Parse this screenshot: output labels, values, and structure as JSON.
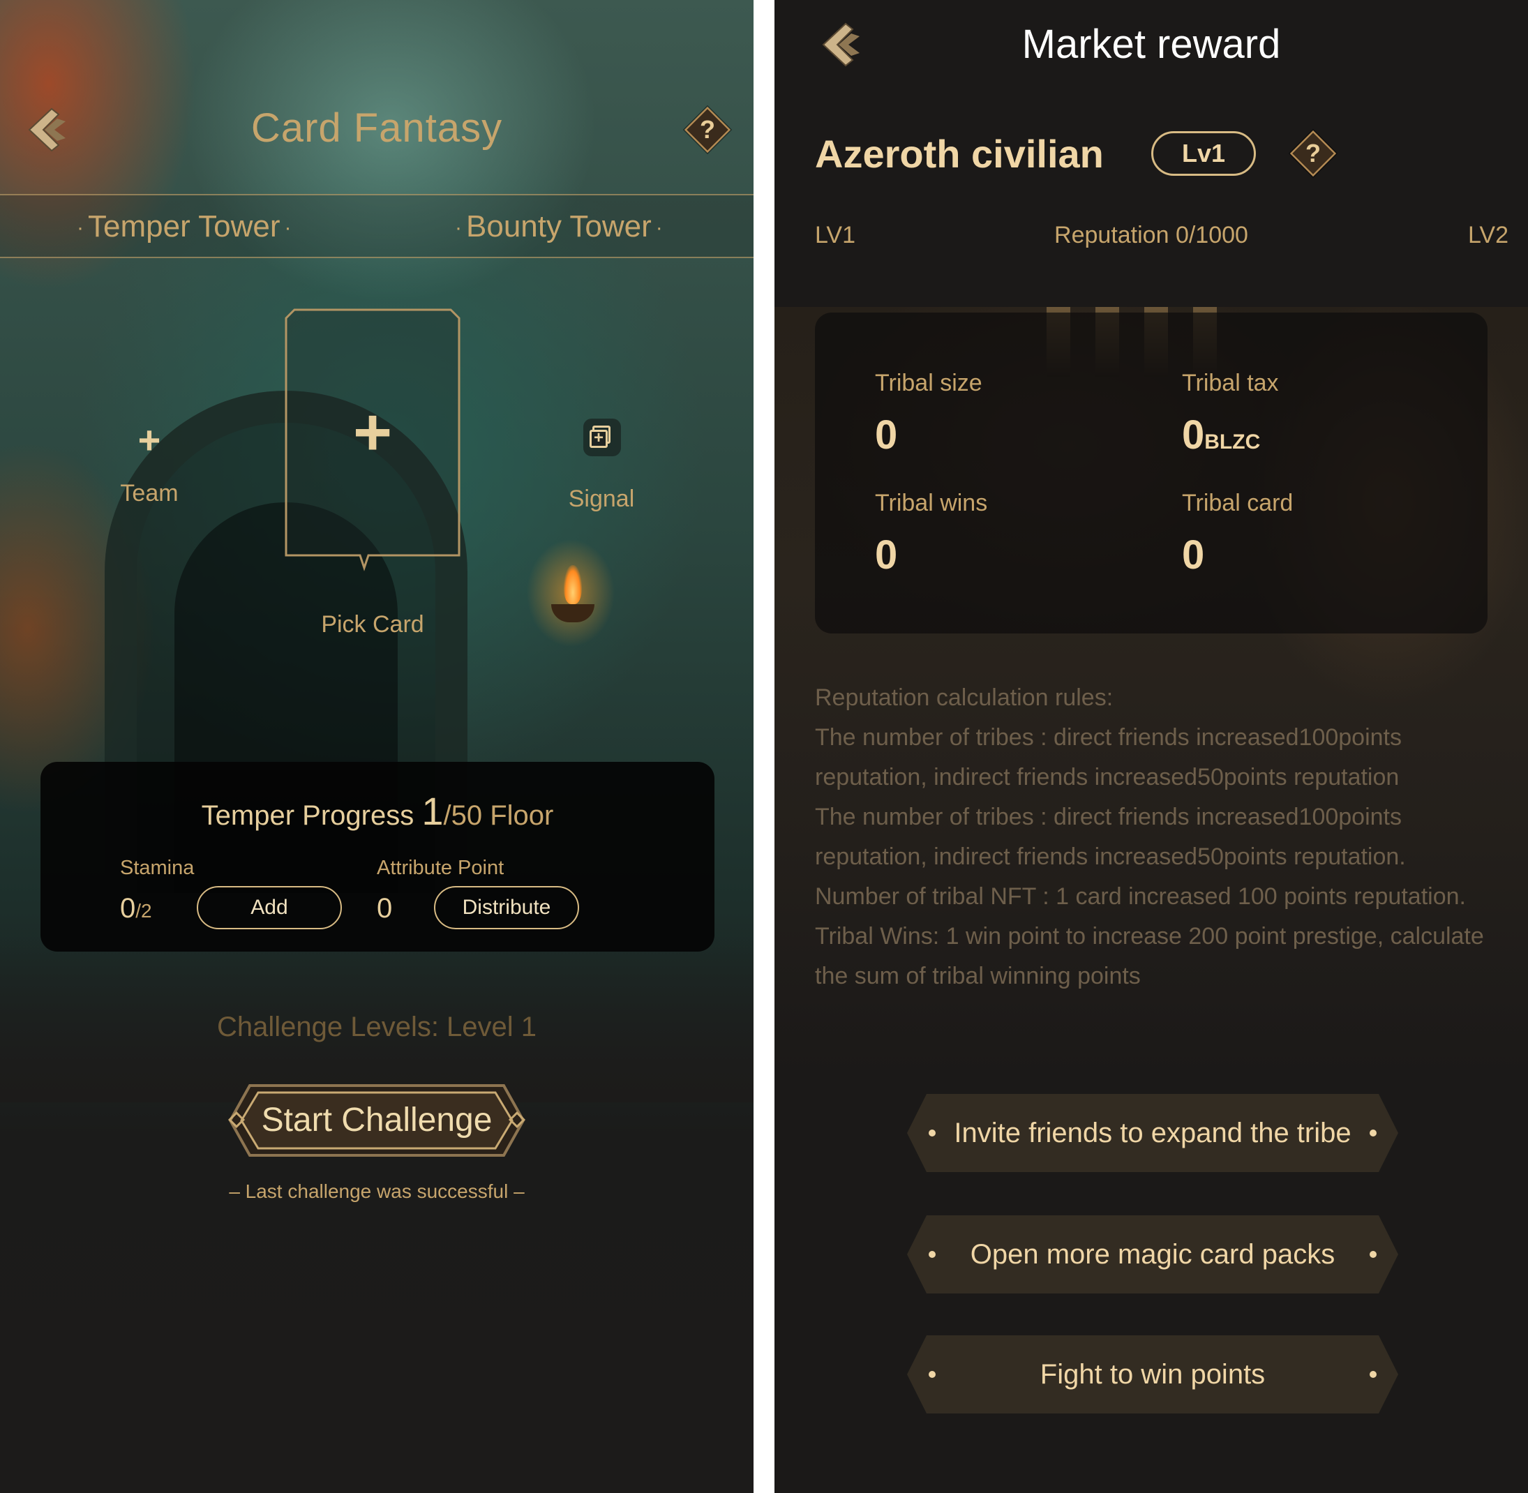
{
  "left": {
    "title": "Card Fantasy",
    "help": "?",
    "tabs": [
      {
        "label": "Temper Tower"
      },
      {
        "label": "Bounty Tower"
      }
    ],
    "team": {
      "label": "Team",
      "icon": "plus-icon"
    },
    "pick_card": {
      "label": "Pick Card",
      "icon": "plus-icon"
    },
    "signal": {
      "label": "Signal",
      "icon": "signal-add-icon"
    },
    "progress": {
      "title_prefix": "Temper Progress",
      "current": "1",
      "total_suffix": "/50 Floor",
      "stamina_label": "Stamina",
      "stamina_value": "0",
      "stamina_max": "/2",
      "add_label": "Add",
      "attribute_label": "Attribute Point",
      "attribute_value": "0",
      "distribute_label": "Distribute"
    },
    "challenge_levels": "Challenge Levels:   Level 1",
    "start_label": "Start Challenge",
    "last_note": "– Last challenge was successful –"
  },
  "right": {
    "title": "Market reward",
    "name": "Azeroth civilian",
    "level_badge": "Lv1",
    "help": "?",
    "rep_left": "LV1",
    "rep_center": "Reputation 0/1000",
    "rep_right": "LV2",
    "reputation_progress": 0,
    "stats": {
      "size_label": "Tribal size",
      "size_value": "0",
      "tax_label": "Tribal tax",
      "tax_value": "0",
      "tax_unit": "BLZC",
      "wins_label": "Tribal wins",
      "wins_value": "0",
      "card_label": "Tribal card",
      "card_value": "0"
    },
    "rules": [
      "Reputation calculation rules:",
      "The number of tribes : direct friends increased100points reputation, indirect friends increased50points reputation",
      "The number of tribes : direct friends increased100points reputation, indirect friends increased50points reputation.",
      "Number of tribal NFT : 1 card increased 100 points reputation.",
      "Tribal Wins: 1 win point to increase 200 point prestige, calculate the sum of tribal winning points"
    ],
    "actions": [
      {
        "label": "Invite friends to expand the tribe"
      },
      {
        "label": "Open more magic card packs"
      },
      {
        "label": "Fight to win points"
      }
    ]
  },
  "colors": {
    "gold": "#c7a56c",
    "light_gold": "#f0d6a6",
    "dark_bg": "#1b1918"
  }
}
